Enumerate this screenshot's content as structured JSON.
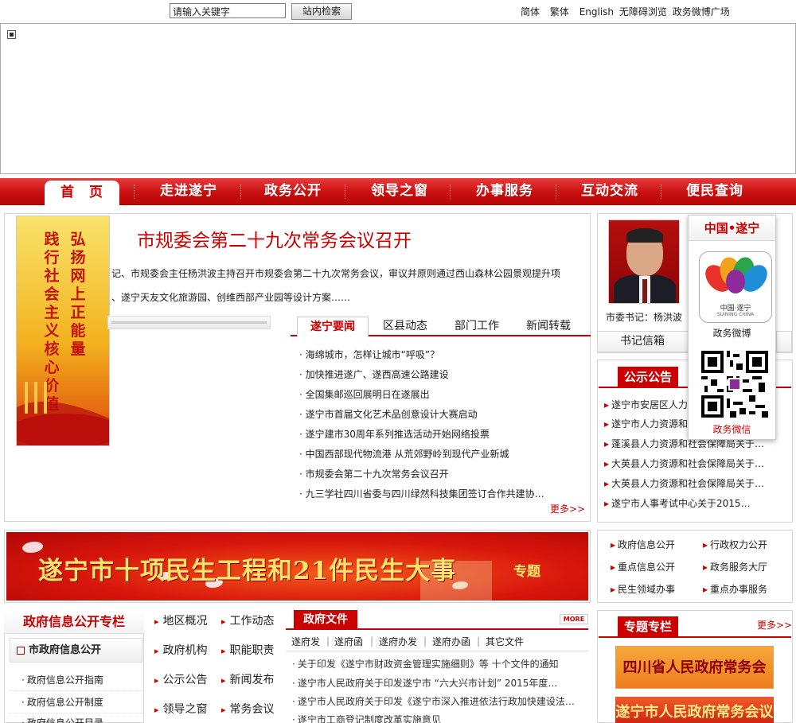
{
  "topbar": {
    "search_placeholder": "请输入关键字",
    "search_button": "站内检索",
    "links": [
      "简体",
      "繁体",
      "English",
      "无障碍浏览",
      "政务微博广场"
    ]
  },
  "nav": {
    "items": [
      "首　页",
      "走进遂宁",
      "政务公开",
      "领导之窗",
      "办事服务",
      "互动交流",
      "便民查询"
    ],
    "active_color": "#c00000"
  },
  "feature": {
    "vertical_banner": [
      "弘扬网上正能量",
      "践行社会主义核心价值观"
    ],
    "headline": "市规委会第二十九次常务会议召开",
    "summary": [
      "记、市规委会主任杨洪波主持召开市规委会第二十九次常务会议，审议并原则通过西山森林公园景观提升项",
      "、遂宁天友文化旅游园、创维西部产业园等设计方案……"
    ]
  },
  "news": {
    "tabs": [
      "遂宁要闻",
      "区县动态",
      "部门工作",
      "新闻转载"
    ],
    "items": [
      "海绵城市，怎样让城市“呼吸”？",
      "加快推进遂广、遂西高速公路建设",
      "全国集邮巡回展明日在遂展出",
      "遂宁市首届文化艺术品创意设计大赛启动",
      "遂宁建市30周年系列推选活动开始网络投票",
      "中国西部现代物流港 从荒郊野岭到现代产业新城",
      "市规委会第二十九次常务会议召开",
      "九三学社四川省委与四川绿然科技集团签订合作共建协…"
    ],
    "more": "更多>>"
  },
  "leader": {
    "caption": "市委书记：杨洪波",
    "mailbox": "书记信箱"
  },
  "weibo": {
    "title": "中国•遂宁",
    "logo_text": "中国·遂宁",
    "logo_sub": "SUINING CHINA",
    "weibo_label": "政务微博",
    "weixin_label": "政务微信"
  },
  "notices": {
    "title": "公示公告",
    "items": [
      "遂宁市安居区人力…",
      "遂宁市人力资源和…",
      "蓬溪县人力资源和社会保障局关于…",
      "大英县人力资源和社会保障局关于…",
      "大英县人力资源和社会保障局关于…",
      "遂宁市人事考试中心关于2015…"
    ]
  },
  "banner_red": {
    "text": "遂宁市十项民生工程和21件民生大事",
    "sub": "专题"
  },
  "quicklinks": [
    "政府信息公开",
    "行政权力公开",
    "重点信息公开",
    "政务服务大厅",
    "民生领域办事",
    "重点办事服务"
  ],
  "gov_info": {
    "title": "政府信息公开专栏",
    "subtitle": "市政府信息公开",
    "items": [
      "政府信息公开指南",
      "政府信息公开制度",
      "政府信息公开目录"
    ]
  },
  "mid_links": [
    "地区概况",
    "工作动态",
    "政府机构",
    "职能职责",
    "公示公告",
    "新闻发布",
    "领导之窗",
    "常务会议"
  ],
  "gov_docs": {
    "title": "政府文件",
    "more": "MORE",
    "subtabs": [
      "遂府发",
      "遂府函",
      "遂府办发",
      "遂府办函",
      "其它文件"
    ],
    "items": [
      "关于印发《遂宁市财政资金管理实施细则》等 十个文件的通知",
      "遂宁市人民政府关于印发遂宁市 “六大兴市计划” 2015年度…",
      "遂宁市人民政府关于印发《遂宁市深入推进依法行政加快建设法…",
      "遂宁市工商登记制度改革实施意见"
    ]
  },
  "special": {
    "title": "专题专栏",
    "more": "更多>>",
    "banners": [
      "四川省人民政府常务会议",
      "遂宁市人民政府常务会议"
    ]
  }
}
